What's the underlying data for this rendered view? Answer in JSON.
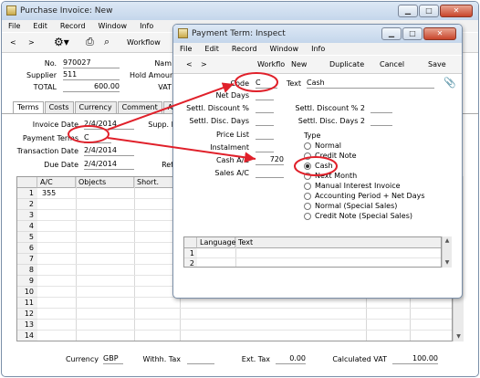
{
  "colors": {
    "annotation_red": "#e0202a",
    "title_gradient": "#c4d6eb"
  },
  "main": {
    "title": "Purchase Invoice: New",
    "menu": [
      "File",
      "Edit",
      "Record",
      "Window",
      "Info"
    ],
    "toolbar": {
      "prev": "<",
      "next": ">",
      "workflow": "Workflow"
    },
    "header": {
      "no_label": "No.",
      "no_value": "970027",
      "supplier_label": "Supplier",
      "supplier_value": "511",
      "total_label": "TOTAL",
      "total_value": "600.00",
      "name_label": "Nam",
      "hold_label": "Hold Amoun",
      "vat_label": "VAT"
    },
    "tabs": [
      "Terms",
      "Costs",
      "Currency",
      "Comment",
      "Account"
    ],
    "terms": {
      "invoice_date_label": "Invoice Date",
      "invoice_date_value": "2/4/2014",
      "payment_terms_label": "Payment Terms",
      "payment_terms_value": "C",
      "transaction_date_label": "Transaction Date",
      "transaction_date_value": "2/4/2014",
      "due_date_label": "Due Date",
      "due_date_value": "2/4/2014",
      "supp_label": "Supp. I",
      "ref_label": "Ref"
    },
    "grid": {
      "headers": [
        "A/C",
        "Objects",
        "Short."
      ],
      "rows": [
        {
          "n": "1",
          "ac": "355"
        },
        {
          "n": "2",
          "ac": ""
        },
        {
          "n": "3",
          "ac": ""
        },
        {
          "n": "4",
          "ac": ""
        },
        {
          "n": "5",
          "ac": ""
        },
        {
          "n": "6",
          "ac": ""
        },
        {
          "n": "7",
          "ac": ""
        },
        {
          "n": "8",
          "ac": ""
        },
        {
          "n": "9",
          "ac": ""
        },
        {
          "n": "10",
          "ac": ""
        },
        {
          "n": "11",
          "ac": ""
        },
        {
          "n": "12",
          "ac": ""
        },
        {
          "n": "13",
          "ac": ""
        },
        {
          "n": "14",
          "ac": ""
        }
      ]
    },
    "footer": {
      "currency_label": "Currency",
      "currency_value": "GBP",
      "withh_label": "Withh. Tax",
      "ext_label": "Ext. Tax",
      "ext_value": "0.00",
      "calc_label": "Calculated VAT",
      "calc_value": "100.00"
    }
  },
  "dialog": {
    "title": "Payment Term: Inspect",
    "menu": [
      "File",
      "Edit",
      "Record",
      "Window",
      "Info"
    ],
    "toolbar": {
      "prev": "<",
      "next": ">",
      "workflow": "Workflo",
      "new": "New",
      "duplicate": "Duplicate",
      "cancel": "Cancel",
      "save": "Save"
    },
    "fields": {
      "code_label": "Code",
      "code_value": "C",
      "text_label": "Text",
      "text_value": "Cash",
      "net_days_label": "Net Days",
      "settl_disc_label": "Settl. Discount %",
      "settl_days_label": "Settl. Disc. Days",
      "price_list_label": "Price List",
      "instalment_label": "Instalment",
      "cash_ac_label": "Cash A/C",
      "cash_ac_value": "720",
      "sales_ac_label": "Sales A/C",
      "settl_disc2_label": "Settl. Discount % 2",
      "settl_days2_label": "Settl. Disc. Days 2",
      "type_label": "Type"
    },
    "type_options": [
      {
        "label": "Normal",
        "selected": false
      },
      {
        "label": "Credit Note",
        "selected": false
      },
      {
        "label": "Cash",
        "selected": true
      },
      {
        "label": "Next Month",
        "selected": false
      },
      {
        "label": "Manual Interest Invoice",
        "selected": false
      },
      {
        "label": "Accounting Period + Net Days",
        "selected": false
      },
      {
        "label": "Normal (Special Sales)",
        "selected": false
      },
      {
        "label": "Credit Note (Special Sales)",
        "selected": false
      }
    ],
    "grid": {
      "headers": [
        "Language",
        "Text"
      ],
      "rows": [
        "1",
        "2"
      ]
    }
  }
}
